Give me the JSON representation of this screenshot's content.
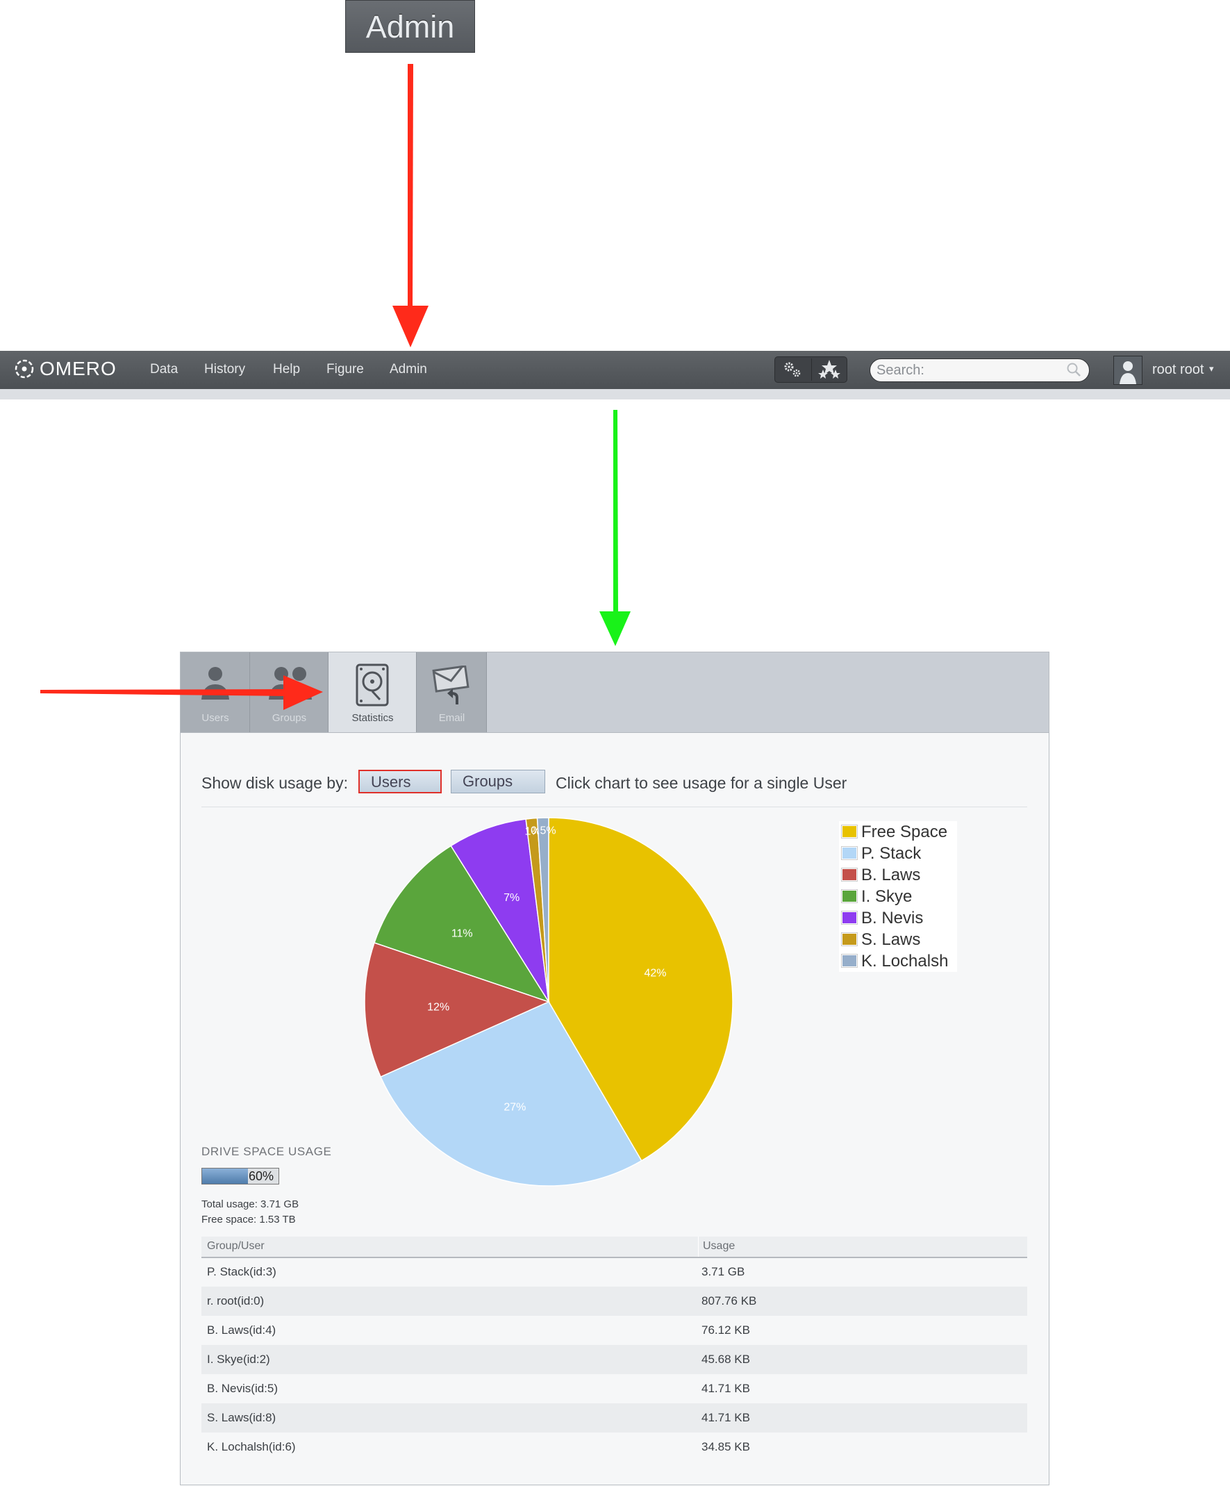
{
  "callout": {
    "label": "Admin"
  },
  "navbar": {
    "logo": "OMERO",
    "items": [
      "Data",
      "History",
      "Help",
      "Figure",
      "Admin"
    ],
    "search_placeholder": "Search:",
    "user_name": "root root",
    "caret": "▾",
    "bg_color": "#55595e"
  },
  "admin_tabs": [
    {
      "label": "Users",
      "icon": "user-icon",
      "active": false
    },
    {
      "label": "Groups",
      "icon": "group-icon",
      "active": false
    },
    {
      "label": "Statistics",
      "icon": "hard-drive-icon",
      "active": true
    },
    {
      "label": "Email",
      "icon": "email-icon",
      "active": false
    }
  ],
  "statistics": {
    "prompt": "Show disk usage by:",
    "toggle_users": "Users",
    "toggle_groups": "Groups",
    "hint": "Click chart to see usage for a single User",
    "drive": {
      "title": "DRIVE SPACE USAGE",
      "percent_label": "60%",
      "percent_value": 0.6,
      "total_usage": "Total usage: 3.71 GB",
      "free_space": "Free space: 1.53 TB"
    },
    "table": {
      "headers": [
        "Group/User",
        "Usage"
      ],
      "rows": [
        [
          "P. Stack(id:3)",
          "3.71 GB"
        ],
        [
          "r. root(id:0)",
          "807.76 KB"
        ],
        [
          "B. Laws(id:4)",
          "76.12 KB"
        ],
        [
          "I. Skye(id:2)",
          "45.68 KB"
        ],
        [
          "B. Nevis(id:5)",
          "41.71 KB"
        ],
        [
          "S. Laws(id:8)",
          "41.71 KB"
        ],
        [
          "K. Lochalsh(id:6)",
          "34.85 KB"
        ]
      ]
    }
  },
  "chart_data": {
    "type": "pie",
    "categories": [
      "Free Space",
      "P. Stack",
      "B. Laws",
      "I. Skye",
      "B. Nevis",
      "S. Laws",
      "K. Lochalsh"
    ],
    "values": [
      42,
      27,
      12,
      11,
      7,
      1,
      1
    ],
    "data_labels": [
      "42%",
      "27%",
      "12%",
      "11%",
      "7%",
      "1%",
      "0.5%"
    ],
    "colors": [
      "#e8c200",
      "#b3d7f7",
      "#c4504a",
      "#5aa53c",
      "#8e3cf0",
      "#c59a1b",
      "#96aeca"
    ],
    "legend": "top-right"
  },
  "annotations": {
    "red_color": "#ff2a1a",
    "green_color": "#19f219"
  }
}
